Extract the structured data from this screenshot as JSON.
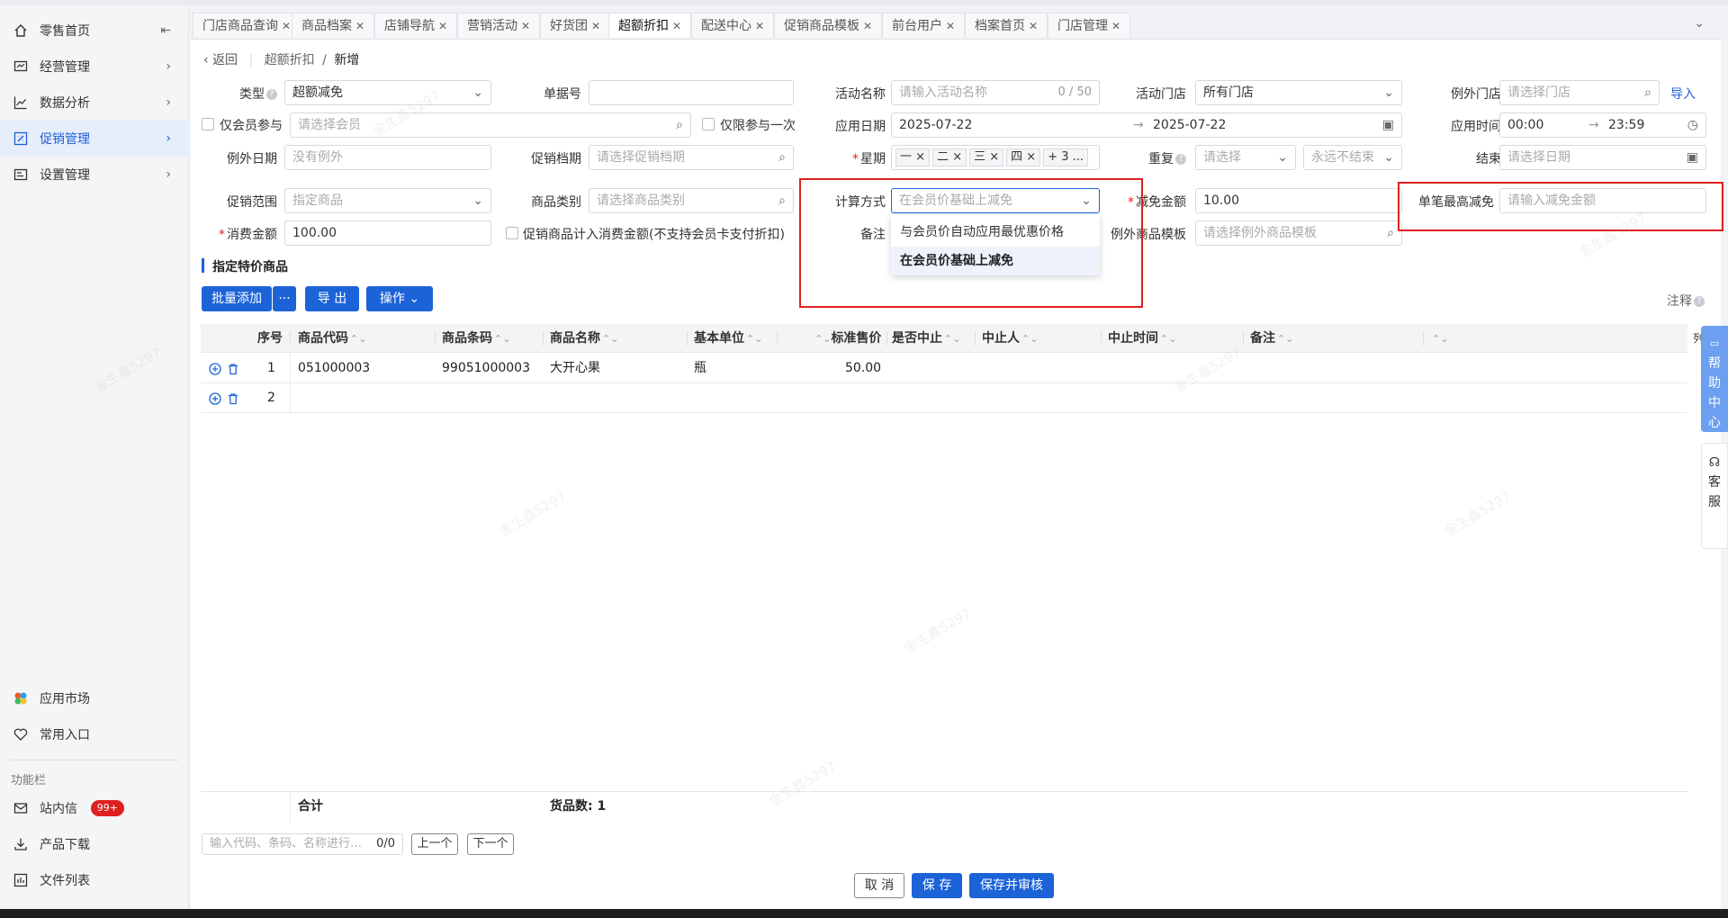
{
  "sidebar": {
    "items": [
      {
        "label": "零售首页",
        "icon": "home-icon"
      },
      {
        "label": "经营管理",
        "icon": "monitor-icon"
      },
      {
        "label": "数据分析",
        "icon": "chart-line-icon"
      },
      {
        "label": "促销管理",
        "icon": "promo-icon",
        "active": true
      },
      {
        "label": "设置管理",
        "icon": "settings-box-icon"
      }
    ],
    "bottom": [
      {
        "label": "应用市场",
        "icon": "app-market-icon"
      },
      {
        "label": "常用入口",
        "icon": "heart-icon"
      }
    ],
    "section_label": "功能栏",
    "func": [
      {
        "label": "站内信",
        "icon": "mail-icon",
        "badge": "99+"
      },
      {
        "label": "产品下载",
        "icon": "download-icon"
      },
      {
        "label": "文件列表",
        "icon": "file-list-icon"
      }
    ],
    "collapse_icon": "collapse-icon"
  },
  "tabs": [
    {
      "label": "门店商品查询"
    },
    {
      "label": "商品档案"
    },
    {
      "label": "店铺导航"
    },
    {
      "label": "营销活动"
    },
    {
      "label": "好货团"
    },
    {
      "label": "超额折扣",
      "active": true
    },
    {
      "label": "配送中心"
    },
    {
      "label": "促销商品模板"
    },
    {
      "label": "前台用户"
    },
    {
      "label": "档案首页"
    },
    {
      "label": "门店管理"
    }
  ],
  "breadcrumb": {
    "back": "返回",
    "parent": "超额折扣",
    "sep": "/",
    "current": "新增"
  },
  "form": {
    "type_label": "类型",
    "type_value": "超额减免",
    "bill_no_label": "单据号",
    "bill_no_value": "",
    "activity_name_label": "活动名称",
    "activity_name_placeholder": "请输入活动名称",
    "activity_name_count": "0 / 50",
    "activity_store_label": "活动门店",
    "activity_store_value": "所有门店",
    "except_store_label": "例外门店",
    "except_store_placeholder": "请选择门店",
    "import_label": "导入",
    "member_only_label": "仅会员参与",
    "member_placeholder": "请选择会员",
    "once_only_label": "仅限参与一次",
    "apply_date_label": "应用日期",
    "apply_date_start": "2025-07-22",
    "apply_date_end": "2025-07-22",
    "apply_time_label": "应用时间",
    "apply_time_start": "00:00",
    "apply_time_end": "23:59",
    "range_arrow": "→",
    "except_date_label": "例外日期",
    "except_date_placeholder": "没有例外",
    "promo_period_label": "促销档期",
    "promo_period_placeholder": "请选择促销档期",
    "weekday_label": "星期",
    "weekday_tags": [
      "一",
      "二",
      "三",
      "四"
    ],
    "weekday_more": "+ 3 ...",
    "repeat_label": "重复",
    "repeat_placeholder": "请选择",
    "repeat_end_value": "永远不结束",
    "end_label": "结束",
    "end_placeholder": "请选择日期",
    "promo_range_label": "促销范围",
    "promo_range_value": "指定商品",
    "category_label": "商品类别",
    "category_placeholder": "请选择商品类别",
    "calc_label": "计算方式",
    "calc_placeholder": "在会员价基础上减免",
    "discount_label": "减免金额",
    "discount_value": "10.00",
    "max_discount_label": "单笔最高减免",
    "max_discount_placeholder": "请输入减免金额",
    "spend_label": "消费金额",
    "spend_value": "100.00",
    "include_promo_label": "促销商品计入消费金额(不支持会员卡支付折扣)",
    "remark_label": "备注",
    "except_template_label": "例外商品模板",
    "except_template_placeholder": "请选择例外商品模板"
  },
  "dropdown": {
    "options": [
      {
        "label": "与会员价自动应用最优惠价格",
        "selected": false
      },
      {
        "label": "在会员价基础上减免",
        "selected": true
      }
    ]
  },
  "section_title": "指定特价商品",
  "toolbar": {
    "batch_add": "批量添加",
    "more": "···",
    "export": "导 出",
    "operate": "操作",
    "note": "注释"
  },
  "table": {
    "columns": [
      "序号",
      "商品代码",
      "商品条码",
      "商品名称",
      "基本单位",
      "标准售价",
      "是否中止",
      "中止人",
      "中止时间",
      "备注"
    ],
    "rows": [
      {
        "index": "1",
        "code": "051000003",
        "barcode": "99051000003",
        "name": "大开心果",
        "unit": "瓶",
        "price": "50.00"
      },
      {
        "index": "2",
        "code": "",
        "barcode": "",
        "name": "",
        "unit": "",
        "price": ""
      }
    ],
    "footer_total": "合计",
    "footer_count": "货品数: 1",
    "column_setting": "列"
  },
  "search": {
    "placeholder": "输入代码、条码、名称进行…",
    "count": "0/0",
    "prev": "上一个",
    "next": "下一个"
  },
  "actions": {
    "cancel": "取 消",
    "save": "保 存",
    "save_review": "保存并审核"
  },
  "help": {
    "help_center": "帮助中心",
    "service": "客服"
  },
  "watermark": "金生鑫5297",
  "accent": "#1d63d8",
  "highlight_color": "#e02020"
}
